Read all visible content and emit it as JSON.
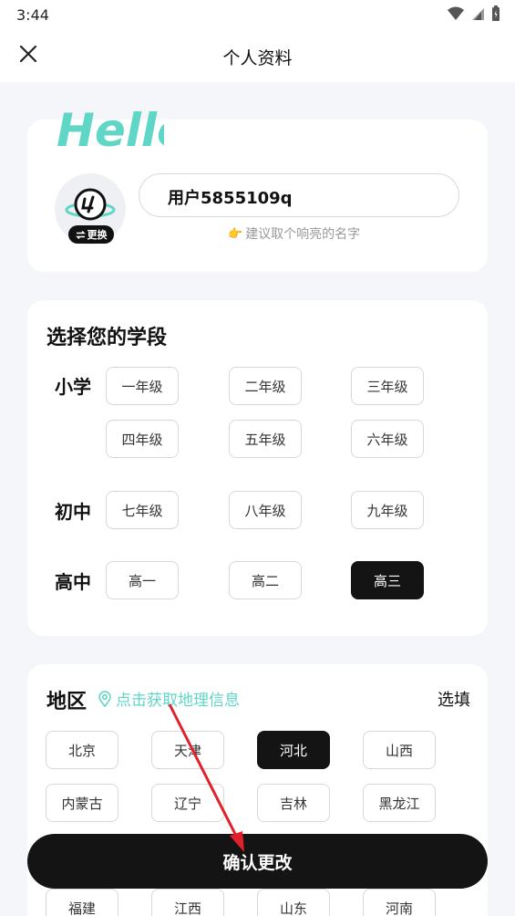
{
  "status": {
    "time": "3:44"
  },
  "header": {
    "title": "个人资料"
  },
  "profile": {
    "hello_text": "Hello!",
    "avatar_change_label": "更换",
    "username": "用户5855109q",
    "hint": "建议取个响亮的名字",
    "hint_emoji": "👉"
  },
  "education": {
    "title": "选择您的学段",
    "groups": [
      {
        "label": "小学",
        "grades": [
          "一年级",
          "二年级",
          "三年级",
          "四年级",
          "五年级",
          "六年级"
        ]
      },
      {
        "label": "初中",
        "grades": [
          "七年级",
          "八年级",
          "九年级"
        ]
      },
      {
        "label": "高中",
        "grades": [
          "高一",
          "高二",
          "高三"
        ],
        "selected": "高三"
      }
    ]
  },
  "region": {
    "title": "地区",
    "locate_link": "点击获取地理信息",
    "optional_label": "选填",
    "provinces": [
      "北京",
      "天津",
      "河北",
      "山西",
      "内蒙古",
      "辽宁",
      "吉林",
      "黑龙江",
      "福建",
      "江西",
      "山东",
      "河南"
    ],
    "selected": "河北"
  },
  "footer": {
    "confirm_label": "确认更改"
  },
  "colors": {
    "accent": "#5fd6c6",
    "dark": "#141414",
    "background": "#f5f6fa",
    "annotation_arrow": "#e0202a"
  }
}
